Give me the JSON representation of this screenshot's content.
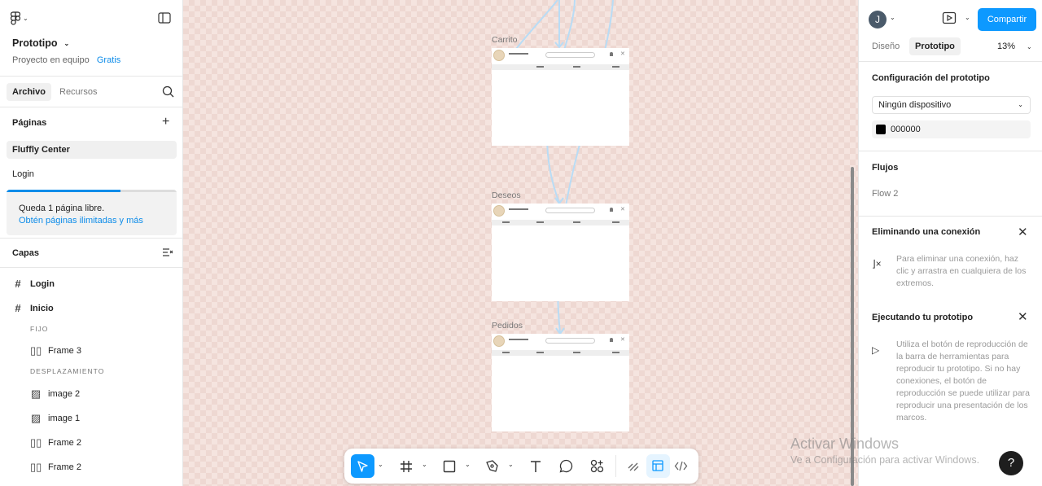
{
  "left": {
    "project_title": "Prototipo",
    "team": "Proyecto en equipo",
    "plan": "Gratis",
    "tabs": [
      "Archivo",
      "Recursos"
    ],
    "pages_heading": "Páginas",
    "pages": [
      "Fluffly Center",
      "Login"
    ],
    "quota_text": "Queda 1 página libre.",
    "quota_link": "Obtén páginas ilimitadas y más",
    "quota_fraction": 0.67,
    "layers_heading": "Capas",
    "layers": {
      "login": "Login",
      "inicio": "Inicio",
      "fixed_label": "FIJO",
      "frame3": "Frame 3",
      "scroll_label": "DESPLAZAMIENTO",
      "image2": "image 2",
      "image1": "image 1",
      "frame2a": "Frame 2",
      "frame2b": "Frame 2"
    }
  },
  "canvas": {
    "frames": [
      "Carrito",
      "Deseos",
      "Pedidos"
    ]
  },
  "right": {
    "user_initial": "J",
    "share": "Compartir",
    "tabs": [
      "Diseño",
      "Prototipo"
    ],
    "zoom": "13%",
    "proto_config_title": "Configuración del prototipo",
    "device": "Ningún dispositivo",
    "bg_color": "000000",
    "flows_title": "Flujos",
    "flow": "Flow 2",
    "remove_title": "Eliminando una conexión",
    "remove_text": "Para eliminar una conexión, haz clic y arrastra en cualquiera de los extremos.",
    "run_title": "Ejecutando tu prototipo",
    "run_text": "Utiliza el botón de reproducción de la barra de herramientas para reproducir tu prototipo. Si no hay conexiones, el botón de reproducción se puede utilizar para reproducir una presentación de los marcos."
  },
  "watermark": {
    "line1": "Activar Windows",
    "line2": "Ve a Configuración para activar Windows."
  },
  "help": "?",
  "colors": {
    "accent": "#0d99ff",
    "link": "#0d8ce9",
    "canvas": "#f5e4df"
  }
}
